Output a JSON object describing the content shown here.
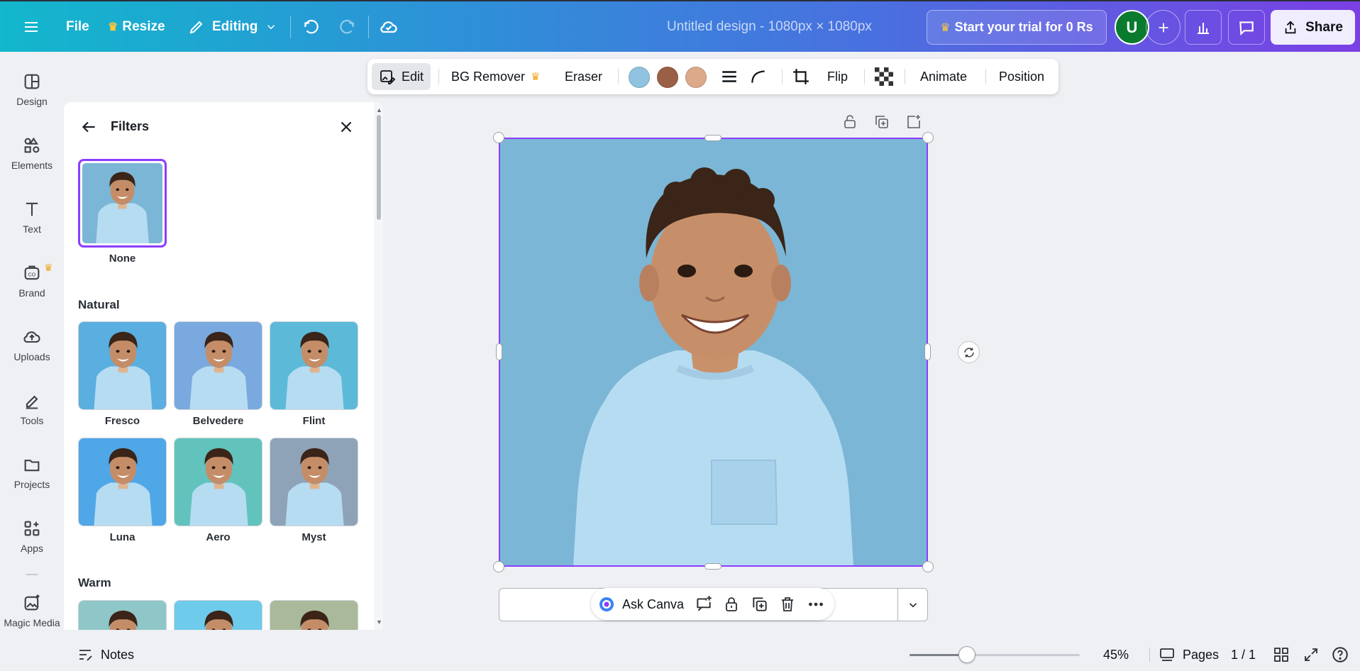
{
  "header": {
    "file_label": "File",
    "resize_label": "Resize",
    "editing_label": "Editing",
    "document_title": "Untitled design - 1080px × 1080px",
    "trial_label": "Start your trial for 0 Rs",
    "avatar_initial": "U",
    "share_label": "Share",
    "colors": {
      "avatar_bg": "#0a7a2f",
      "crown": "#ffc83d"
    }
  },
  "rail": {
    "items": [
      {
        "label": "Design",
        "icon": "design-icon"
      },
      {
        "label": "Elements",
        "icon": "elements-icon"
      },
      {
        "label": "Text",
        "icon": "text-icon"
      },
      {
        "label": "Brand",
        "icon": "brand-icon"
      },
      {
        "label": "Uploads",
        "icon": "uploads-icon"
      },
      {
        "label": "Tools",
        "icon": "tools-icon"
      },
      {
        "label": "Projects",
        "icon": "projects-icon"
      },
      {
        "label": "Apps",
        "icon": "apps-icon"
      },
      {
        "label": "Magic Media",
        "icon": "magic-media-icon"
      }
    ]
  },
  "filters": {
    "title": "Filters",
    "none_label": "None",
    "sections": [
      {
        "name": "Natural",
        "items": [
          "Fresco",
          "Belvedere",
          "Flint",
          "Luna",
          "Aero",
          "Myst"
        ]
      },
      {
        "name": "Warm",
        "items": []
      }
    ]
  },
  "context_toolbar": {
    "edit_label": "Edit",
    "bg_remover_label": "BG Remover",
    "eraser_label": "Eraser",
    "swatches": [
      "#8fc3e0",
      "#9a5f45",
      "#dca98a"
    ],
    "flip_label": "Flip",
    "animate_label": "Animate",
    "position_label": "Position"
  },
  "canvas": {
    "ask_canva_label": "Ask Canva"
  },
  "footer": {
    "notes_label": "Notes",
    "zoom_value": "45%",
    "zoom_level": 0.45,
    "pages_label": "Pages",
    "page_counter": "1 / 1"
  }
}
